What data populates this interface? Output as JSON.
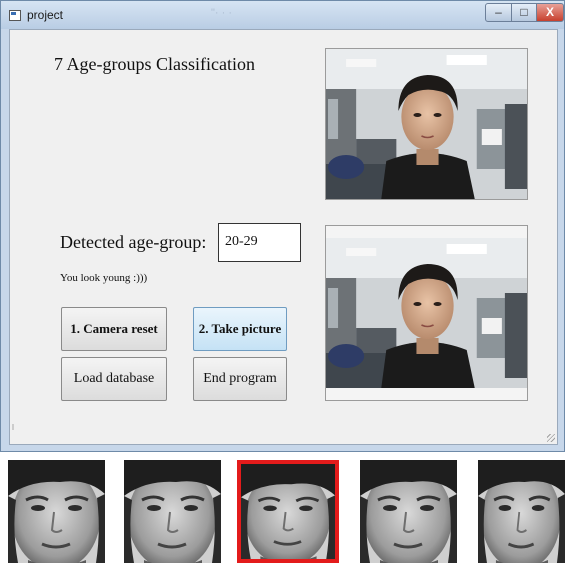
{
  "window": {
    "title": "project",
    "ghost_title": "\"· · ·",
    "controls": {
      "minimize": "–",
      "maximize": "□",
      "close": "X"
    }
  },
  "main": {
    "heading": "7 Age-groups Classification",
    "detected_label": "Detected age-group:",
    "detected_value": "20-29",
    "message": "You look young :)))"
  },
  "buttons": {
    "camera_reset": "1. Camera reset",
    "take_picture": "2. Take picture",
    "load_database": "Load database",
    "end_program": "End program"
  },
  "faces": {
    "count": 5,
    "selected_index": 2,
    "selected_color": "#e31b1b"
  }
}
